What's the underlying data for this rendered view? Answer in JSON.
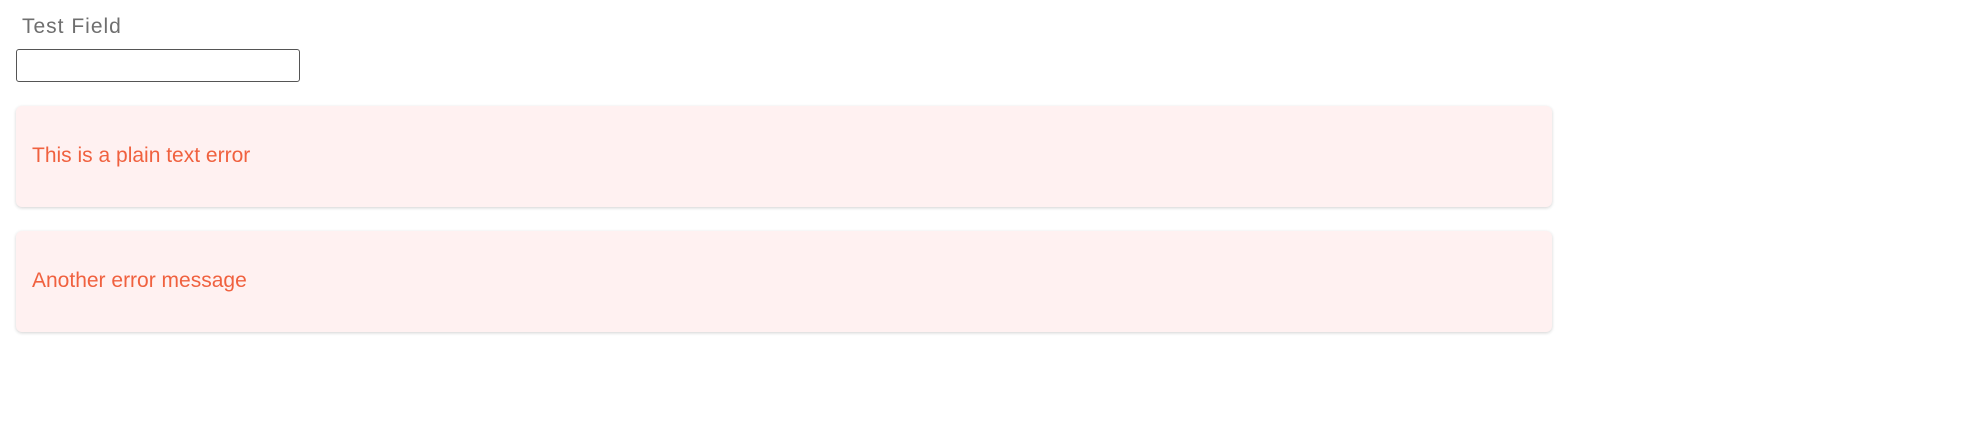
{
  "form": {
    "field_label": "Test Field",
    "field_value": "",
    "field_placeholder": ""
  },
  "errors": [
    {
      "message": "This is a plain text error"
    },
    {
      "message": "Another error message"
    }
  ],
  "colors": {
    "label": "#6f6f6f",
    "input_border": "#555555",
    "error_background": "#fff1f1",
    "error_text": "#f0613f"
  }
}
